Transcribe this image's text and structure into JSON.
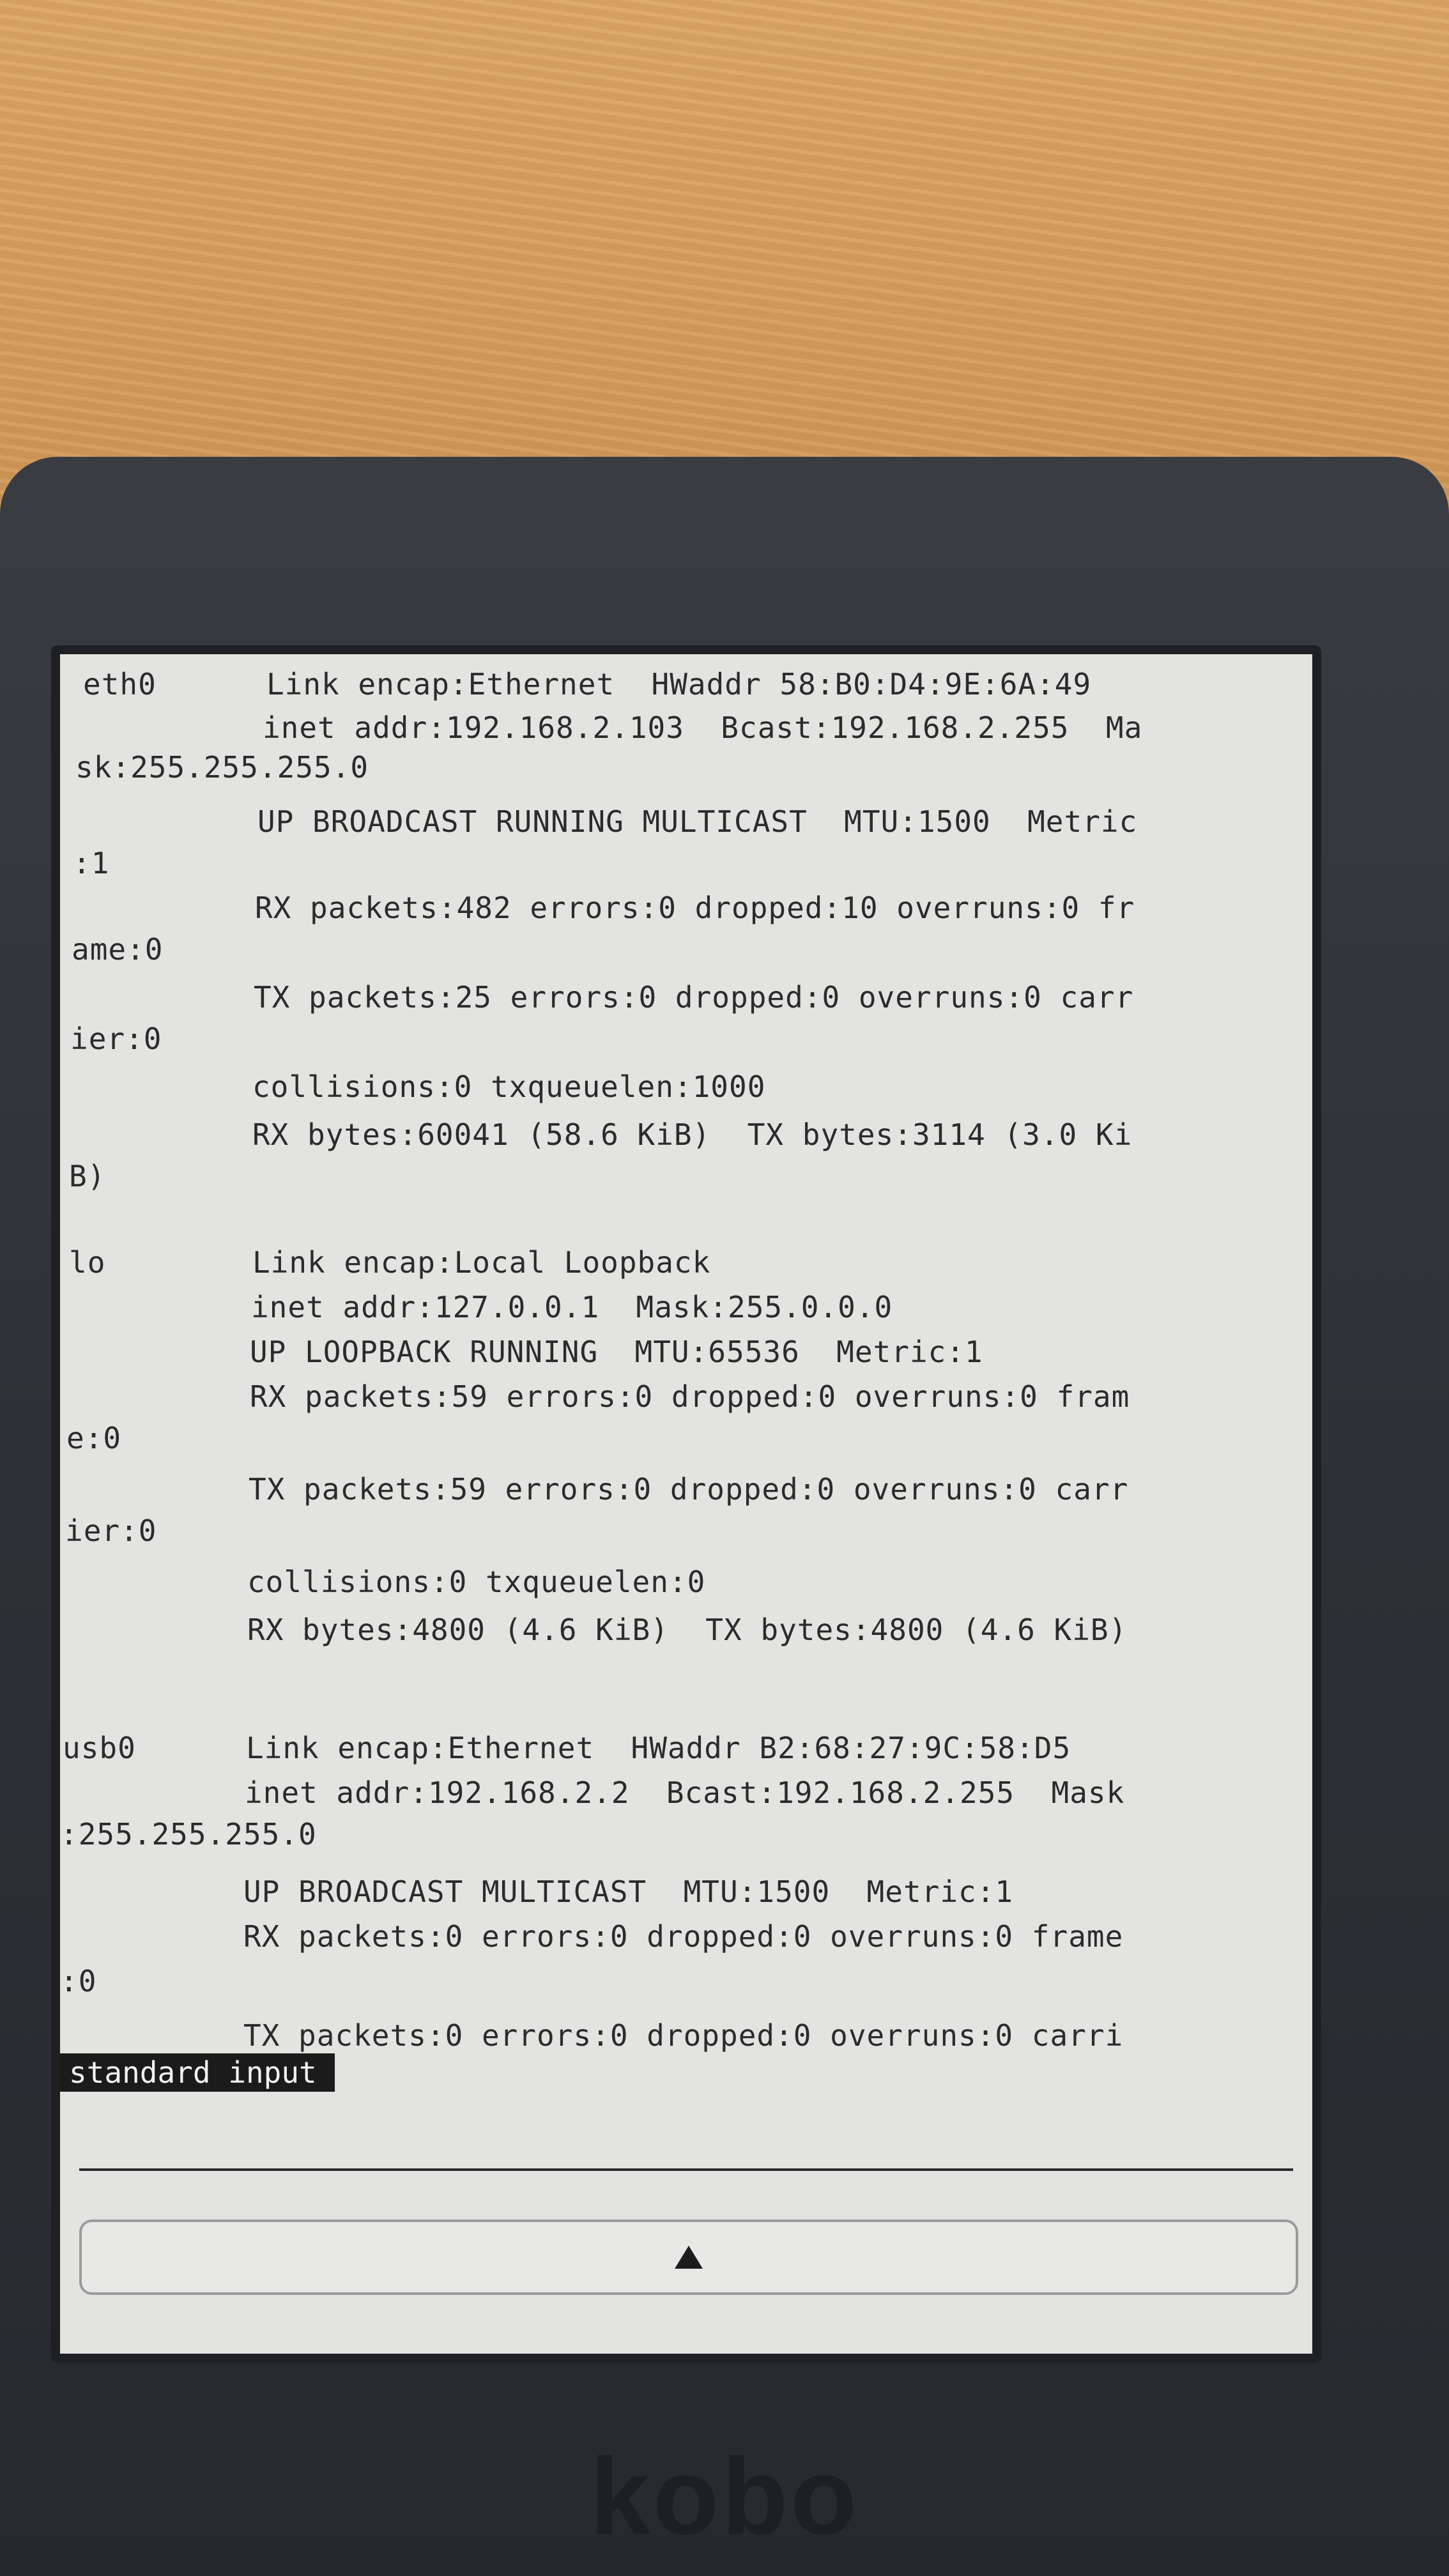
{
  "terminal": {
    "lines": [
      "eth0      Link encap:Ethernet  HWaddr 58:B0:D4:9E:6A:49",
      "          inet addr:192.168.2.103  Bcast:192.168.2.255  Ma",
      "sk:255.255.255.0",
      "          UP BROADCAST RUNNING MULTICAST  MTU:1500  Metric",
      ":1",
      "          RX packets:482 errors:0 dropped:10 overruns:0 fr",
      "ame:0",
      "          TX packets:25 errors:0 dropped:0 overruns:0 carr",
      "ier:0",
      "          collisions:0 txqueuelen:1000",
      "          RX bytes:60041 (58.6 KiB)  TX bytes:3114 (3.0 Ki",
      "B)",
      "",
      "lo        Link encap:Local Loopback",
      "          inet addr:127.0.0.1  Mask:255.0.0.0",
      "          UP LOOPBACK RUNNING  MTU:65536  Metric:1",
      "          RX packets:59 errors:0 dropped:0 overruns:0 fram",
      "e:0",
      "          TX packets:59 errors:0 dropped:0 overruns:0 carr",
      "ier:0",
      "          collisions:0 txqueuelen:0",
      "          RX bytes:4800 (4.6 KiB)  TX bytes:4800 (4.6 KiB)",
      "",
      "usb0      Link encap:Ethernet  HWaddr B2:68:27:9C:58:D5",
      "          inet addr:192.168.2.2  Bcast:192.168.2.255  Mask",
      ":255.255.255.0",
      "          UP BROADCAST MULTICAST  MTU:1500  Metric:1",
      "          RX packets:0 errors:0 dropped:0 overruns:0 frame",
      ":0",
      "          TX packets:0 errors:0 dropped:0 overruns:0 carri"
    ]
  },
  "status_label": "standard input",
  "toggle_icon": "up-triangle-icon",
  "brand": "kobo"
}
